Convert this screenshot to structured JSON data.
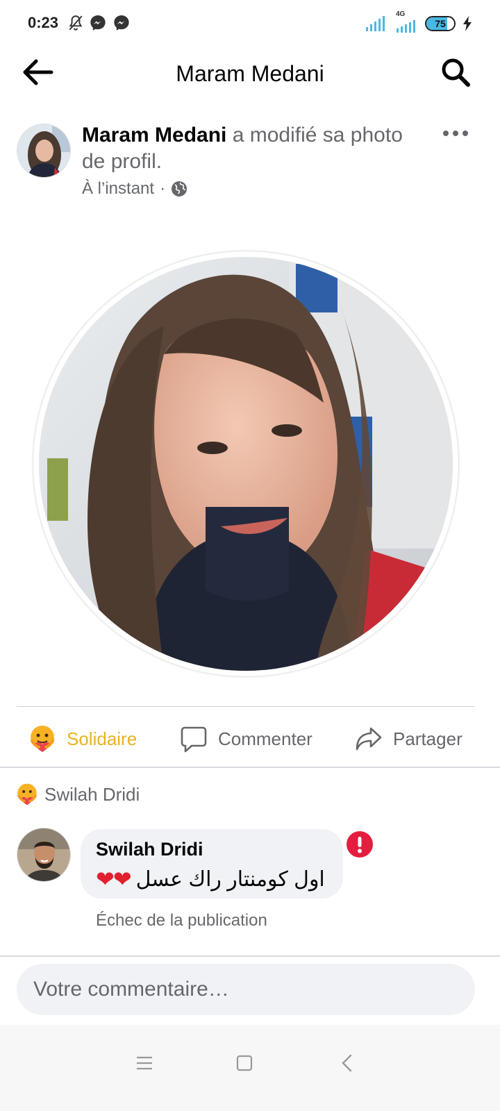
{
  "status_bar": {
    "time": "0:23",
    "network": "4G",
    "battery_level": "75",
    "battery_fraction": 0.75,
    "accent_color": "#49b8e3",
    "icons": [
      "bell-off-icon",
      "messenger-icon",
      "messenger-icon",
      "signal-icon",
      "signal-4g-icon",
      "battery-icon",
      "charging-icon"
    ]
  },
  "header": {
    "title": "Maram Medani",
    "back_icon": "arrow-left-icon",
    "search_icon": "search-icon"
  },
  "post": {
    "author": "Maram Medani",
    "action_text": " a modifié sa photo de profil.",
    "time": "À l’instant",
    "separator": "·",
    "privacy_icon": "globe-icon",
    "more_icon": "more-icon"
  },
  "actions": {
    "solidaire": "Solidaire",
    "comment": "Commenter",
    "share": "Partager",
    "solidaire_color": "#e8b322"
  },
  "reactions": {
    "reactor_name": "Swilah Dridi",
    "icon": "care-emoji-icon"
  },
  "comment": {
    "author": "Swilah Dridi",
    "text": "اول كومنتار راك عسل",
    "hearts": "❤❤",
    "status": "Échec de la publication",
    "error_color": "#e41e3f"
  },
  "composer": {
    "placeholder": "Votre commentaire…"
  },
  "navbar": {
    "icons": [
      "menu-icon",
      "home-square-icon",
      "back-chevron-icon"
    ]
  }
}
